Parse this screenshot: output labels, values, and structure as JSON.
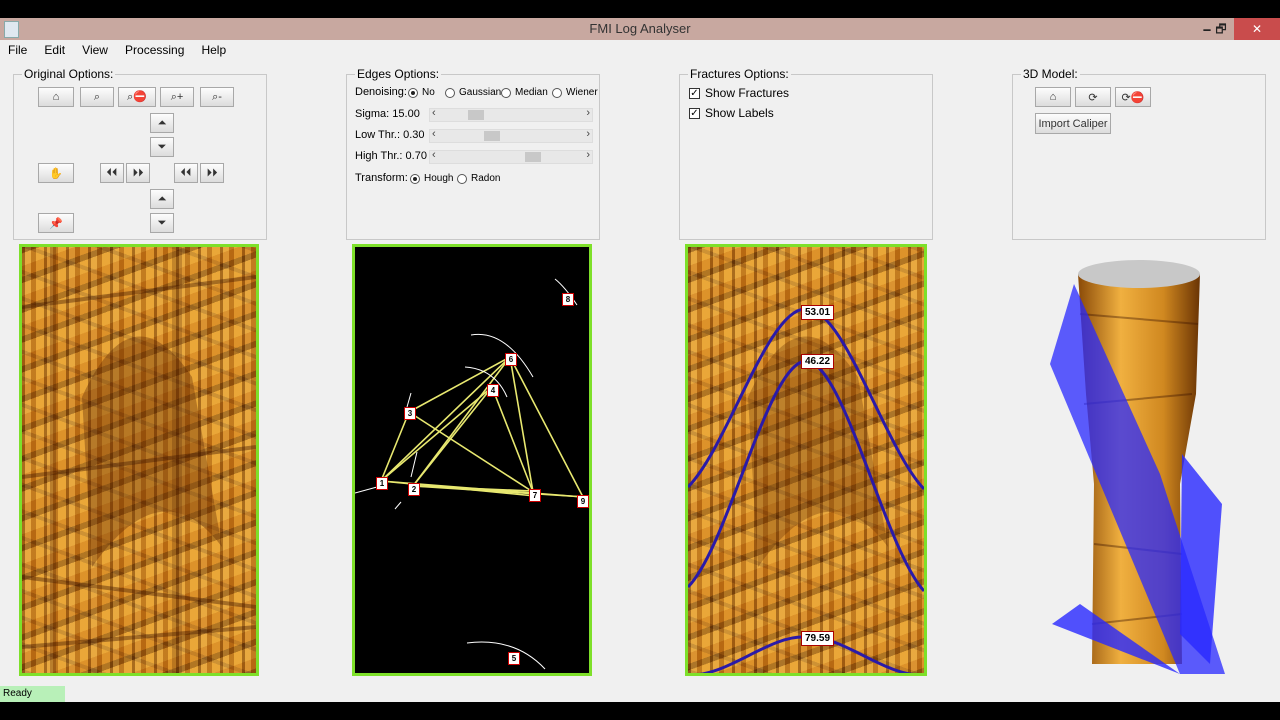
{
  "window": {
    "title": "FMI Log Analyser",
    "minimize": "🗕",
    "maximize": "🗗",
    "close": "✕"
  },
  "menu": [
    "File",
    "Edit",
    "View",
    "Processing",
    "Help"
  ],
  "original": {
    "title": "Original Options:",
    "home_icon": "⌂",
    "zoom_icon": "⌕",
    "zoom_reset_icon": "⌕⛔",
    "zoom_in_icon": "⌕+",
    "zoom_out_icon": "⌕-",
    "pan_icon": "✋",
    "pin_icon": "📌",
    "up_double": "⏶",
    "down_double": "⏷",
    "left_double": "⏴⏴",
    "right_double": "⏵⏵"
  },
  "edges": {
    "title": "Edges Options:",
    "denoising_label": "Denoising:",
    "denoising_options": [
      "No",
      "Gaussian",
      "Median",
      "Wiener"
    ],
    "denoising_selected": "No",
    "sigma_label": "Sigma: 15.00",
    "low_label": "Low Thr.: 0.30",
    "high_label": "High Thr.: 0.70",
    "transform_label": "Transform:",
    "transform_options": [
      "Hough",
      "Radon"
    ],
    "transform_selected": "Hough",
    "sigma_value": 0.2,
    "low_value": 0.33,
    "high_value": 0.66
  },
  "fractures": {
    "title": "Fractures Options:",
    "show_fractures": "Show Fractures",
    "show_labels": "Show Labels",
    "labels": [
      "53.01",
      "46.22",
      "79.59"
    ]
  },
  "model3d": {
    "title": "3D Model:",
    "import_caliper": "Import Caliper"
  },
  "edge_markers": [
    "1",
    "2",
    "3",
    "4",
    "5",
    "6",
    "7",
    "8",
    "9"
  ],
  "status": "Ready",
  "colors": {
    "panel_border": "#7ee02a",
    "plane": "#2828ff",
    "edge_line": "#e8e870"
  }
}
